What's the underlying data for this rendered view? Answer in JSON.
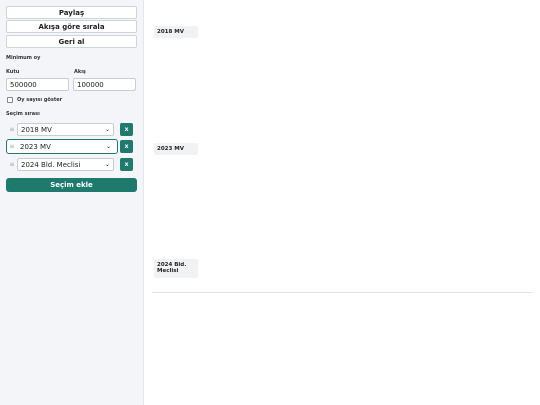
{
  "toolbar": {
    "share_label": "Paylaş",
    "sort_label": "Akışa göre sırala",
    "undo_label": "Geri al"
  },
  "min_votes": {
    "title": "Minimum oy",
    "box_label": "Kutu",
    "box_value": "500000",
    "flow_label": "Akış",
    "flow_value": "100000"
  },
  "show_votes": {
    "label": "Oy sayısı göster",
    "checked": false
  },
  "order": {
    "title": "Seçim sırası",
    "items": [
      {
        "label": "2018 MV",
        "remove": "x"
      },
      {
        "label": "2023 MV",
        "remove": "x"
      },
      {
        "label": "2024 Bld. Meclisi",
        "remove": "x"
      }
    ]
  },
  "add_label": "Seçim ekle",
  "stages": [
    "2018 MV",
    "2023 MV",
    "2024 Bld. Meclisi"
  ],
  "colors": {
    "accent": "#1f7a6e"
  },
  "icons": {
    "handle": "drag-handle-icon",
    "chevron": "chevron-down-icon",
    "remove": "close-icon"
  }
}
